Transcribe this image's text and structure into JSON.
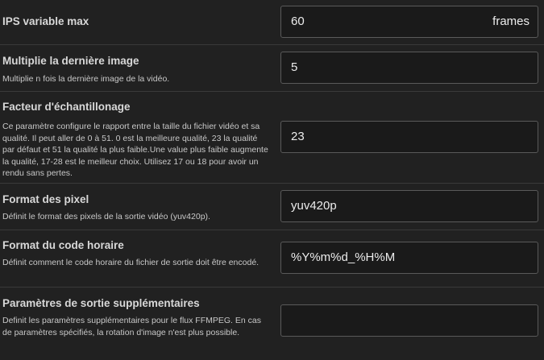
{
  "settings": [
    {
      "title": "IPS variable max",
      "description": "",
      "value": "60",
      "unit": "frames"
    },
    {
      "title": "Multiplie la dernière image",
      "description": "Multiplie n fois la dernière image de la vidéo.",
      "value": "5"
    },
    {
      "title": "Facteur d'échantillonage",
      "description": "Ce paramètre configure le rapport entre la taille du fichier vidéo et sa qualité. Il peut aller de 0 à 51. 0 est la meilleure qualité, 23 la qualité par défaut et 51 la qualité la plus faible.Une value plus faible augmente la qualité, 17-28 est le meilleur choix. Utilisez 17 ou 18 pour avoir un rendu sans pertes.",
      "value": "23"
    },
    {
      "title": "Format des pixel",
      "description": "Définit le format des pixels de la sortie vidéo (yuv420p).",
      "value": "yuv420p"
    },
    {
      "title": "Format du code horaire",
      "description": "Définit comment le code horaire du fichier de sortie doit être encodé.",
      "value": "%Y%m%d_%H%M"
    },
    {
      "title": "Paramètres de sortie supplémentaires",
      "description": "Definit les paramètres supplémentaires pour le flux FFMPEG. En cas de paramètres spécifiés, la rotation d'image n'est plus possible.",
      "value": ""
    }
  ]
}
